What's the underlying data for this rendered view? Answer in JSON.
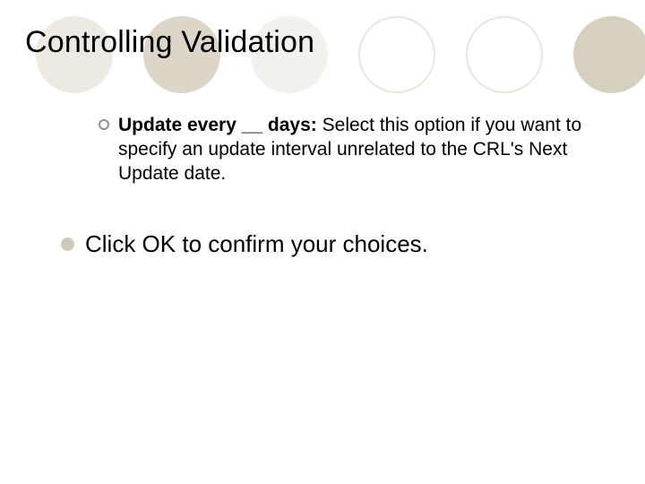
{
  "title": "Controlling Validation",
  "sub": {
    "bold": "Update every __ days:",
    "rest": " Select this option if you want to specify an update interval unrelated to the CRL's Next Update date."
  },
  "main": "Click OK to confirm your choices."
}
